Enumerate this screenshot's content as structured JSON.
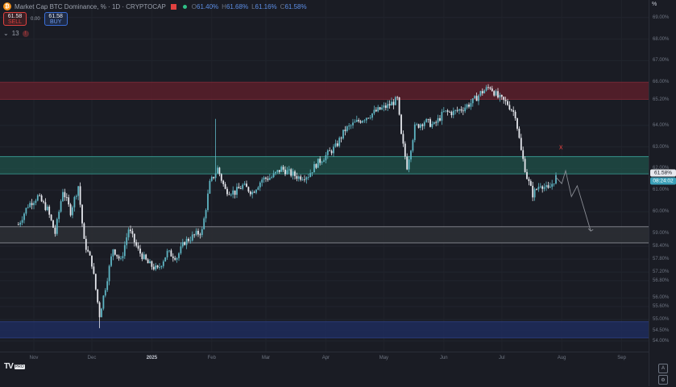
{
  "header": {
    "symbol_badge": "₿",
    "title": "Market Cap BTC Dominance, %",
    "interval": "1D",
    "exchange": "CRYPTOCAP",
    "ohlc": {
      "o_label": "O",
      "o": "61.40%",
      "h_label": "H",
      "h": "61.68%",
      "l_label": "L",
      "l": "61.16%",
      "c_label": "C",
      "c": "61.58%"
    },
    "sell_price": "61.58",
    "sell_label": "SELL",
    "spread": "0.00",
    "buy_price": "61.58",
    "buy_label": "BUY",
    "indicator_toggle": "⌄",
    "indicator_count": "13",
    "alert_badge": "!"
  },
  "axis": {
    "unit_button": "%",
    "current_price": "61.58%",
    "countdown": "08:24:02",
    "logo_text": "TV",
    "logo_badge": "PRO"
  },
  "colors": {
    "background": "#1a1c24",
    "up_candle": "#5fb6c4",
    "down_candle": "#e6e8ee",
    "supply_zone": "#5a1e2a",
    "demand_zone": "#1f4a44",
    "neutral_zone": "#2d2f35",
    "bottom_zone": "#1e2c5c",
    "marker": "#e0413f"
  },
  "chart_data": {
    "type": "candlestick",
    "title": "Market Cap BTC Dominance, %",
    "xlabel": "",
    "ylabel": "",
    "ylim": [
      53.55,
      69.7
    ],
    "y_ticks": [
      "69.00%",
      "68.00%",
      "67.00%",
      "66.00%",
      "65.20%",
      "64.00%",
      "63.00%",
      "62.00%",
      "61.00%",
      "60.00%",
      "59.00%",
      "58.40%",
      "57.80%",
      "57.20%",
      "56.80%",
      "56.00%",
      "55.60%",
      "55.00%",
      "54.50%",
      "54.00%"
    ],
    "x_ticks": [
      "Nov",
      "Dec",
      "2025",
      "Feb",
      "Mar",
      "Apr",
      "May",
      "Jun",
      "Jul",
      "Aug",
      "Sep"
    ],
    "zones": [
      {
        "name": "supply",
        "from": 65.2,
        "to": 66.0
      },
      {
        "name": "demand",
        "from": 61.75,
        "to": 62.55
      },
      {
        "name": "support",
        "from": 58.55,
        "to": 59.3
      },
      {
        "name": "bottom",
        "from": 54.15,
        "to": 54.9
      }
    ],
    "price_path": [
      [
        "2024-10-24",
        59.4
      ],
      [
        "2024-10-29",
        60.3
      ],
      [
        "2024-11-03",
        60.7
      ],
      [
        "2024-11-08",
        60.1
      ],
      [
        "2024-11-12",
        59.0
      ],
      [
        "2024-11-16",
        61.0
      ],
      [
        "2024-11-20",
        60.0
      ],
      [
        "2024-11-24",
        61.2
      ],
      [
        "2024-11-27",
        58.6
      ],
      [
        "2024-12-01",
        57.6
      ],
      [
        "2024-12-05",
        55.2
      ],
      [
        "2024-12-08",
        56.5
      ],
      [
        "2024-12-12",
        58.3
      ],
      [
        "2024-12-16",
        57.7
      ],
      [
        "2024-12-20",
        59.2
      ],
      [
        "2024-12-25",
        58.2
      ],
      [
        "2024-12-30",
        57.6
      ],
      [
        "2025-01-04",
        57.3
      ],
      [
        "2025-01-09",
        58.1
      ],
      [
        "2025-01-14",
        57.9
      ],
      [
        "2025-01-18",
        58.6
      ],
      [
        "2025-01-23",
        58.9
      ],
      [
        "2025-01-27",
        59.1
      ],
      [
        "2025-01-31",
        61.3
      ],
      [
        "2025-02-04",
        62.0
      ],
      [
        "2025-02-08",
        61.0
      ],
      [
        "2025-02-13",
        60.9
      ],
      [
        "2025-02-17",
        61.2
      ],
      [
        "2025-02-22",
        60.9
      ],
      [
        "2025-02-27",
        61.5
      ],
      [
        "2025-03-04",
        61.6
      ],
      [
        "2025-03-09",
        62.0
      ],
      [
        "2025-03-13",
        61.8
      ],
      [
        "2025-03-18",
        61.6
      ],
      [
        "2025-03-23",
        61.7
      ],
      [
        "2025-03-27",
        62.2
      ],
      [
        "2025-04-01",
        62.6
      ],
      [
        "2025-04-06",
        63.0
      ],
      [
        "2025-04-11",
        63.8
      ],
      [
        "2025-04-16",
        64.1
      ],
      [
        "2025-04-22",
        64.4
      ],
      [
        "2025-04-28",
        64.7
      ],
      [
        "2025-05-03",
        64.9
      ],
      [
        "2025-05-08",
        65.2
      ],
      [
        "2025-05-10",
        63.5
      ],
      [
        "2025-05-13",
        62.1
      ],
      [
        "2025-05-17",
        63.9
      ],
      [
        "2025-05-22",
        64.2
      ],
      [
        "2025-05-27",
        64.0
      ],
      [
        "2025-06-01",
        64.6
      ],
      [
        "2025-06-06",
        64.6
      ],
      [
        "2025-06-11",
        64.8
      ],
      [
        "2025-06-16",
        65.1
      ],
      [
        "2025-06-20",
        65.5
      ],
      [
        "2025-06-25",
        65.8
      ],
      [
        "2025-06-29",
        65.3
      ],
      [
        "2025-07-04",
        65.0
      ],
      [
        "2025-07-08",
        64.5
      ],
      [
        "2025-07-11",
        62.8
      ],
      [
        "2025-07-14",
        61.6
      ],
      [
        "2025-07-17",
        60.8
      ],
      [
        "2025-07-21",
        61.3
      ],
      [
        "2025-07-25",
        61.0
      ],
      [
        "2025-07-29",
        61.6
      ]
    ],
    "projection": [
      [
        "2025-07-29",
        61.6
      ],
      [
        "2025-08-01",
        61.3
      ],
      [
        "2025-08-03",
        61.9
      ],
      [
        "2025-08-06",
        60.7
      ],
      [
        "2025-08-09",
        61.2
      ],
      [
        "2025-08-16",
        59.1
      ]
    ],
    "marker": {
      "label": "x",
      "date": "2025-07-29",
      "value": 63.0
    }
  }
}
